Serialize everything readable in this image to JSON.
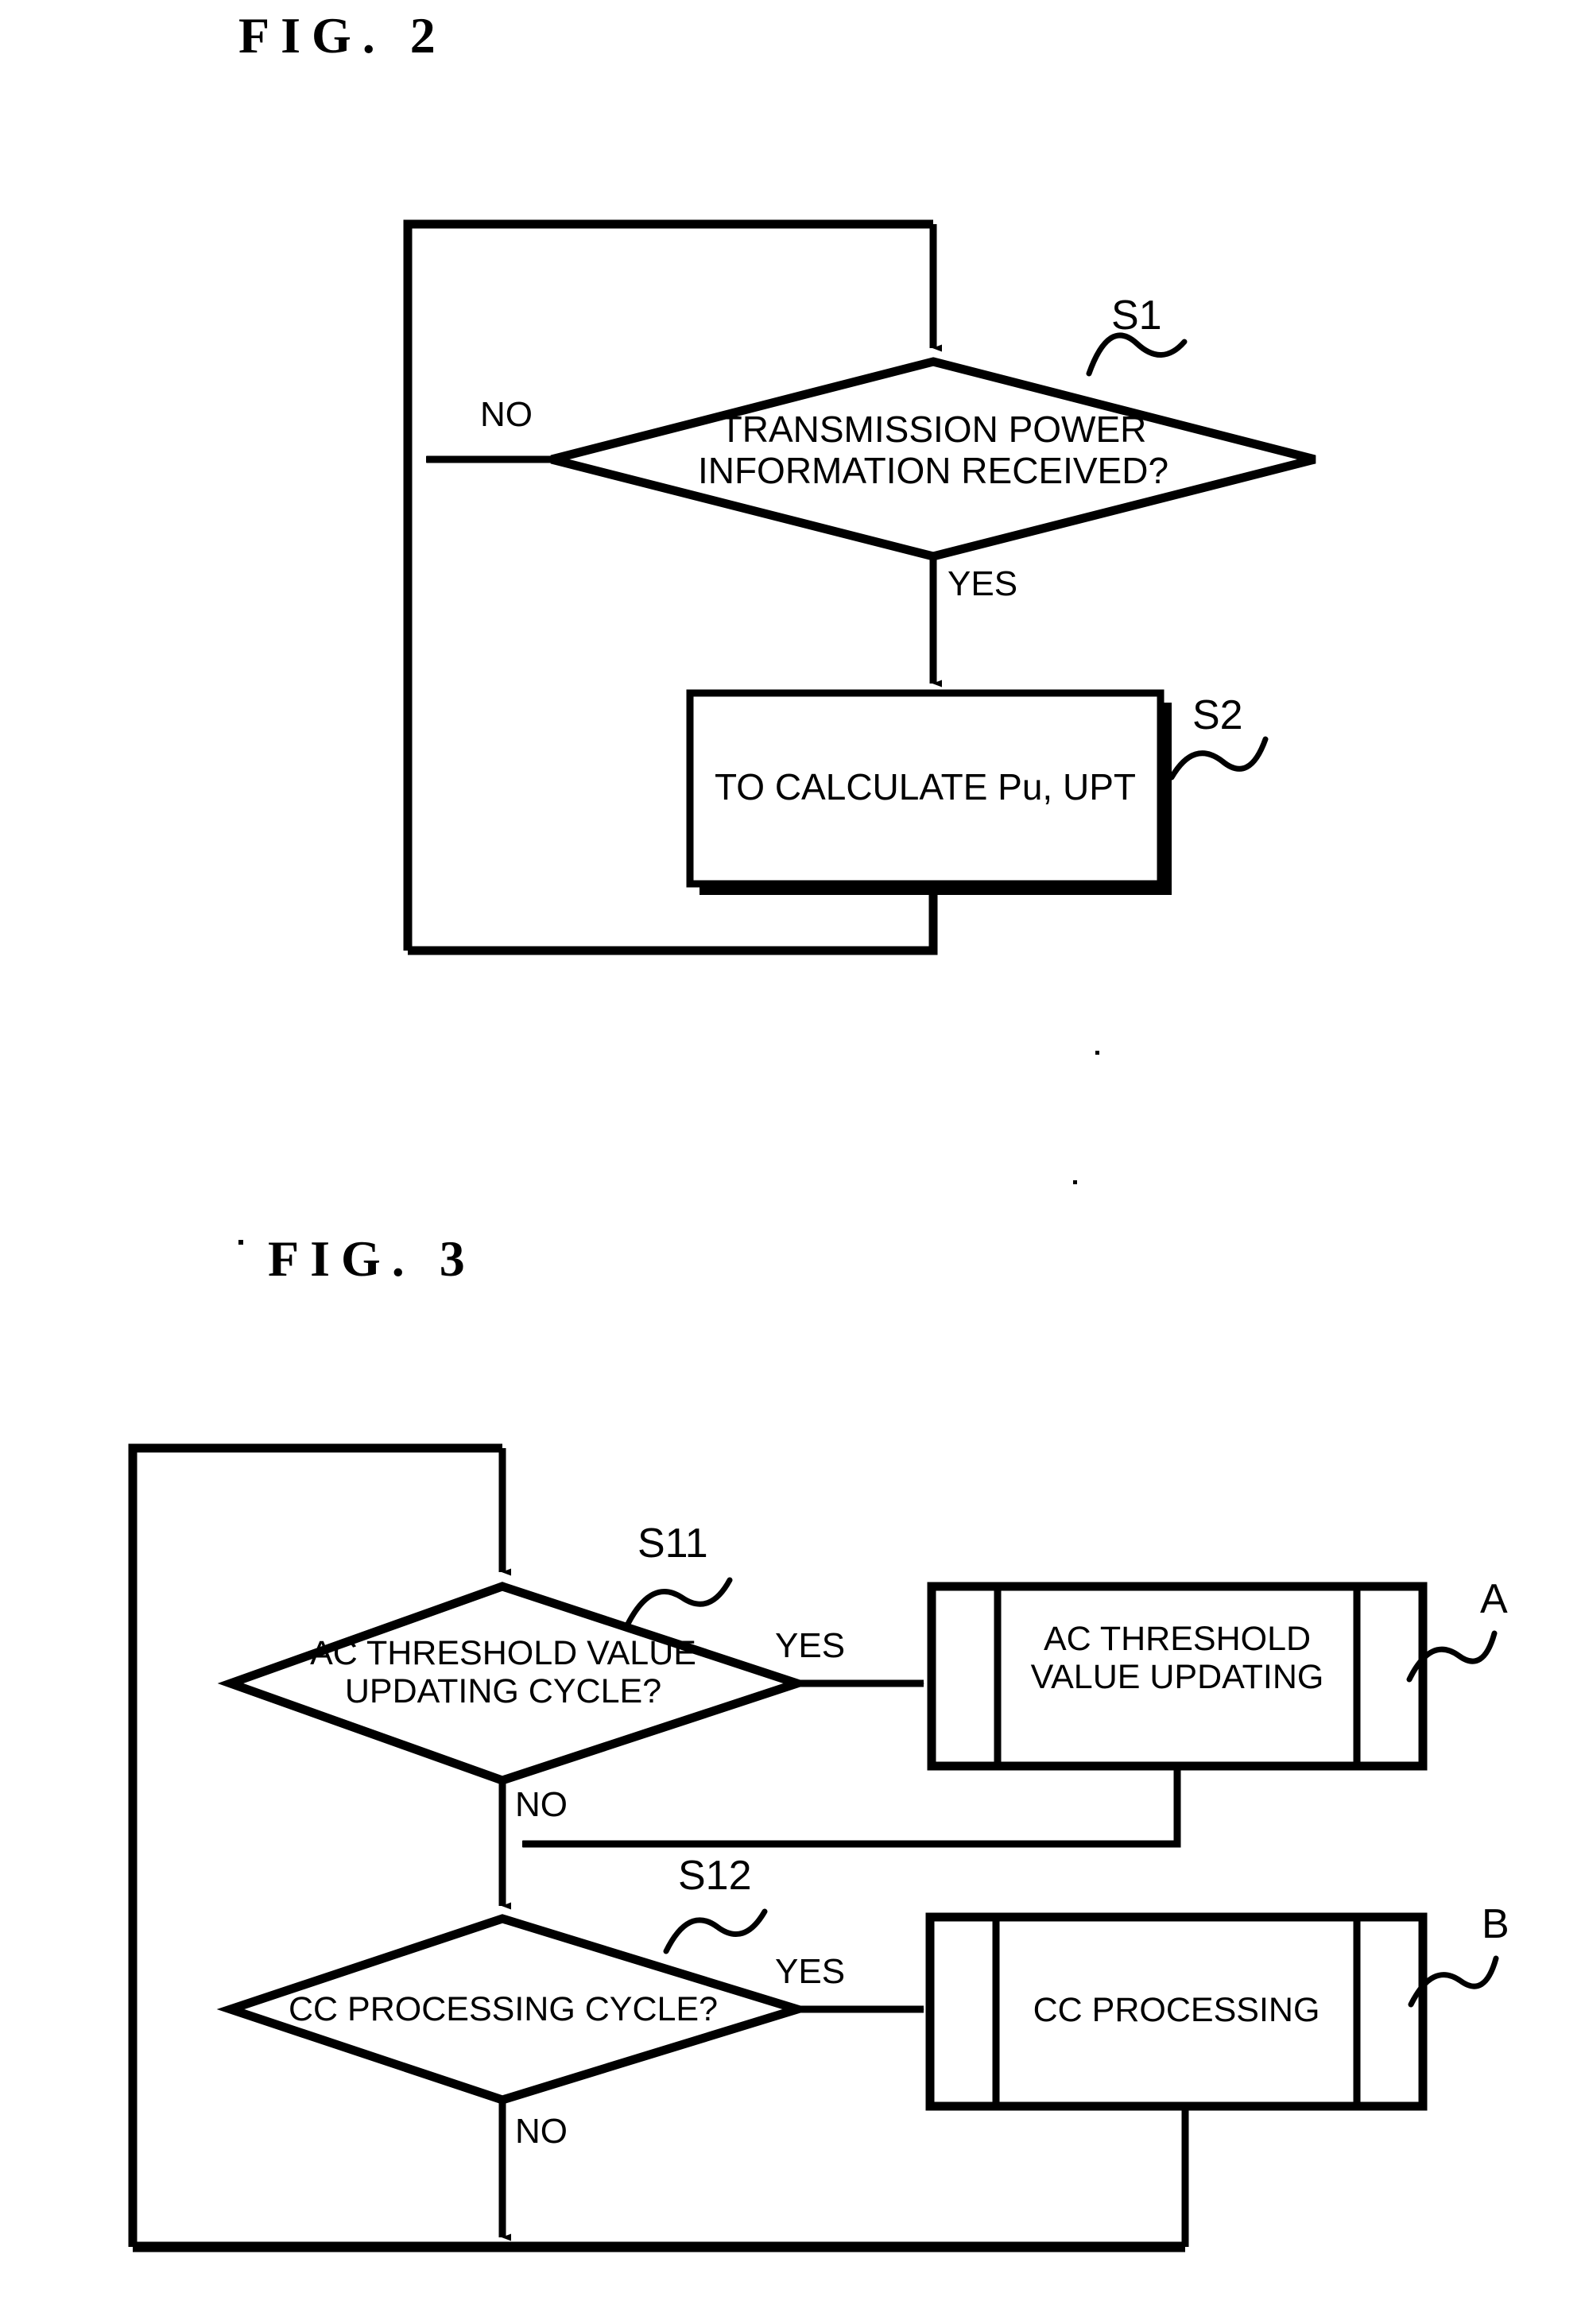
{
  "figures": [
    {
      "id": "fig2",
      "title": "FIG. 2",
      "nodes": [
        {
          "id": "s1",
          "shape": "decision",
          "text_line1": "TRANSMISSION POWER",
          "text_line2": "INFORMATION RECEIVED?",
          "ref": "S1"
        },
        {
          "id": "s2",
          "shape": "process",
          "text_line1": "TO CALCULATE Pu, UPT",
          "text_line2": "",
          "ref": "S2"
        }
      ],
      "edge_labels": {
        "no": "NO",
        "yes": "YES"
      }
    },
    {
      "id": "fig3",
      "title": "FIG. 3",
      "nodes": [
        {
          "id": "s11",
          "shape": "decision",
          "text_line1": "AC THRESHOLD VALUE",
          "text_line2": "UPDATING CYCLE?",
          "ref": "S11"
        },
        {
          "id": "a",
          "shape": "predefined-process",
          "text_line1": "AC THRESHOLD",
          "text_line2": "VALUE UPDATING",
          "ref": "A"
        },
        {
          "id": "s12",
          "shape": "decision",
          "text_line1": "CC PROCESSING CYCLE?",
          "text_line2": "",
          "ref": "S12"
        },
        {
          "id": "b",
          "shape": "predefined-process",
          "text_line1": "CC PROCESSING",
          "text_line2": "",
          "ref": "B"
        }
      ],
      "edge_labels": {
        "yes_1": "YES",
        "no_1": "NO",
        "yes_2": "YES",
        "no_2": "NO"
      }
    }
  ],
  "colors": {
    "ink": "#000000",
    "paper": "#ffffff"
  }
}
